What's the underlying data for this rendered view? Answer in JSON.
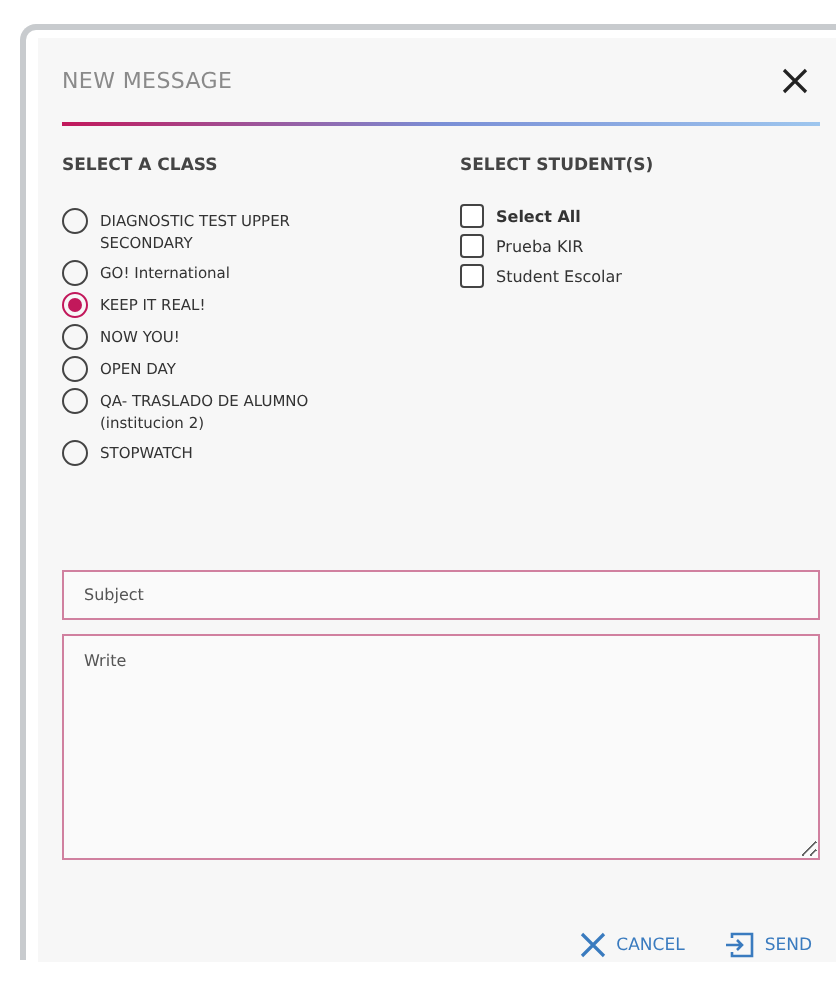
{
  "dialog": {
    "title": "NEW MESSAGE"
  },
  "classes": {
    "heading": "SELECT A CLASS",
    "items": [
      {
        "label": "DIAGNOSTIC TEST UPPER SECONDARY",
        "selected": false
      },
      {
        "label": "GO! International",
        "selected": false
      },
      {
        "label": "KEEP IT REAL!",
        "selected": true
      },
      {
        "label": "NOW YOU!",
        "selected": false
      },
      {
        "label": "OPEN DAY",
        "selected": false
      },
      {
        "label": "QA- TRASLADO DE ALUMNO (institucion 2)",
        "selected": false
      },
      {
        "label": "STOPWATCH",
        "selected": false
      }
    ]
  },
  "students": {
    "heading": "SELECT STUDENT(S)",
    "items": [
      {
        "label": "Select All",
        "checked": false,
        "kind": "all"
      },
      {
        "label": "Prueba KIR",
        "checked": false,
        "kind": "student"
      },
      {
        "label": "Student Escolar",
        "checked": false,
        "kind": "student"
      }
    ]
  },
  "subject": {
    "placeholder": "Subject"
  },
  "body": {
    "placeholder": "Write"
  },
  "buttons": [
    {
      "label": "CANCEL",
      "kind": "cancel"
    },
    {
      "label": "SEND",
      "kind": "send"
    }
  ]
}
